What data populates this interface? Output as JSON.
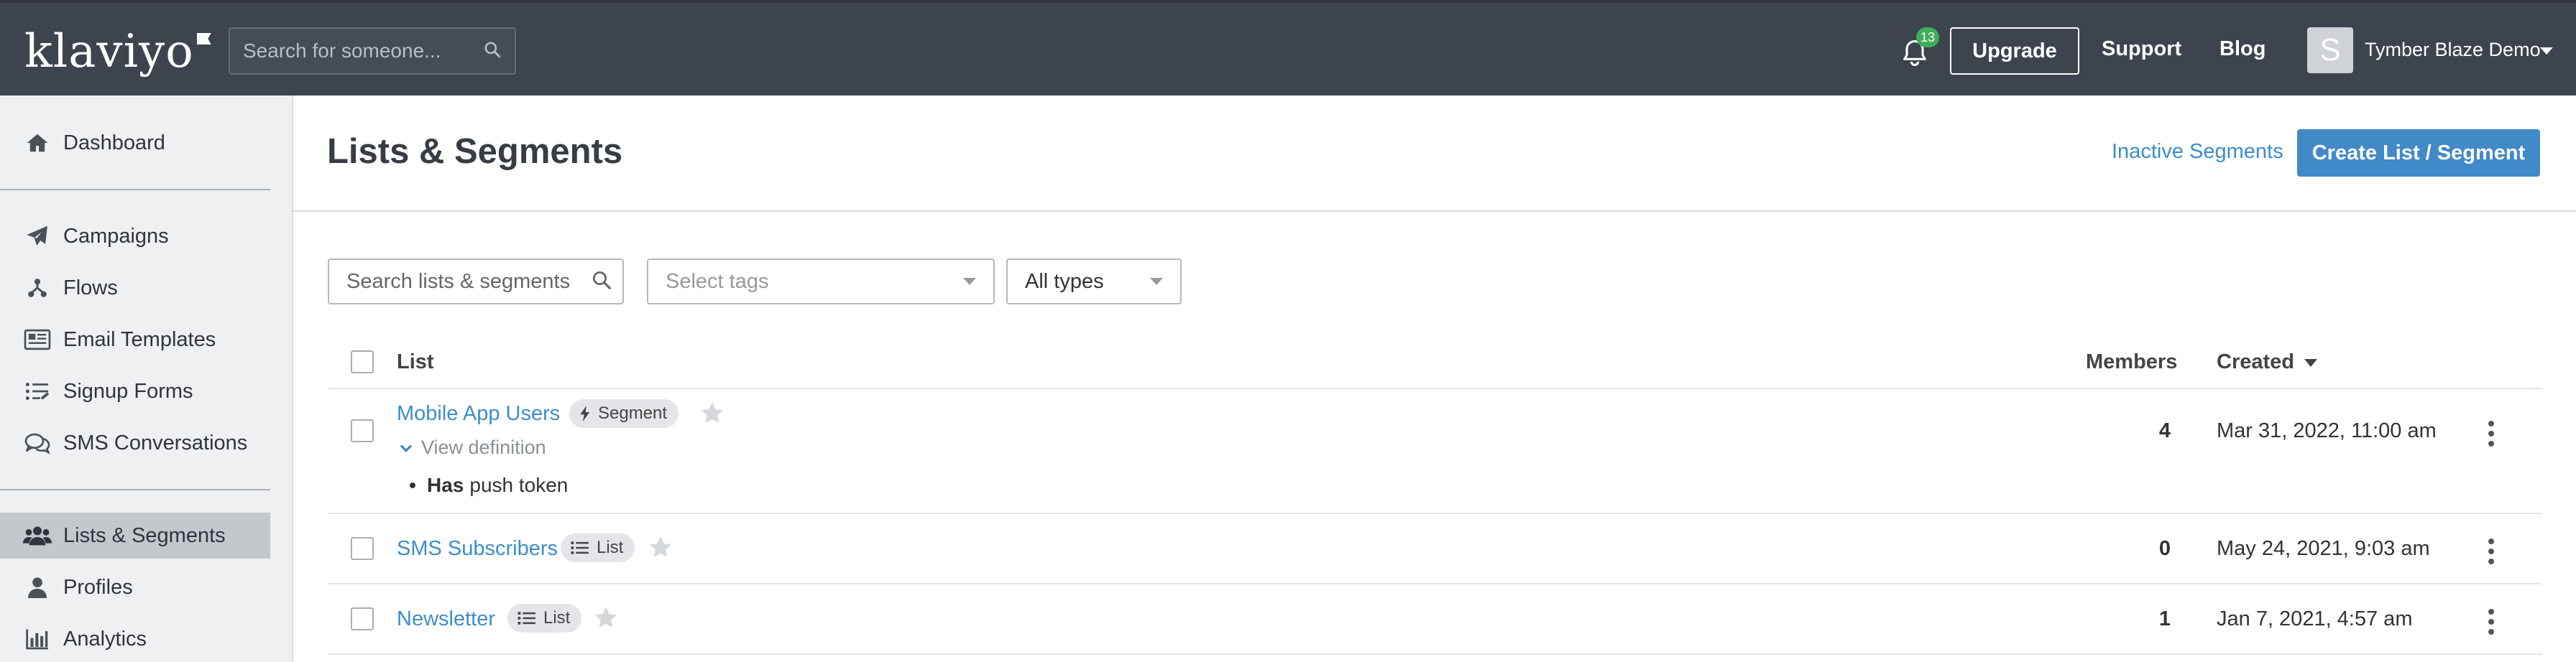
{
  "app": {
    "logo_text": "klaviyo",
    "search_placeholder": "Search for someone...",
    "notification_count": "13",
    "upgrade_label": "Upgrade",
    "support_label": "Support",
    "blog_label": "Blog",
    "avatar_initial": "S",
    "account_name": "Tymber Blaze Demo"
  },
  "sidebar": {
    "items": [
      {
        "label": "Dashboard",
        "icon": "home-icon"
      },
      {
        "label": "Campaigns",
        "icon": "paper-plane-icon"
      },
      {
        "label": "Flows",
        "icon": "flows-icon"
      },
      {
        "label": "Email Templates",
        "icon": "email-template-icon"
      },
      {
        "label": "Signup Forms",
        "icon": "signup-forms-icon"
      },
      {
        "label": "SMS Conversations",
        "icon": "chat-bubbles-icon"
      },
      {
        "label": "Lists & Segments",
        "icon": "users-icon",
        "active": true
      },
      {
        "label": "Profiles",
        "icon": "user-icon"
      },
      {
        "label": "Analytics",
        "icon": "bar-chart-icon"
      }
    ]
  },
  "page": {
    "title": "Lists & Segments",
    "inactive_segments_label": "Inactive Segments",
    "create_button_label": "Create List / Segment"
  },
  "filters": {
    "search_placeholder": "Search lists & segments",
    "tags_placeholder": "Select tags",
    "types_value": "All types"
  },
  "table": {
    "columns": {
      "list": "List",
      "members": "Members",
      "created": "Created"
    },
    "rows": [
      {
        "name": "Mobile App Users",
        "type": "Segment",
        "type_icon": "lightning-icon",
        "view_definition": "View definition",
        "definition_keyword": "Has",
        "definition_text": "push token",
        "members": "4",
        "created": "Mar 31, 2022, 11:00 am"
      },
      {
        "name": "SMS Subscribers",
        "type": "List",
        "type_icon": "list-icon",
        "members": "0",
        "created": "May 24, 2021, 9:03 am"
      },
      {
        "name": "Newsletter",
        "type": "List",
        "type_icon": "list-icon",
        "members": "1",
        "created": "Jan 7, 2021, 4:57 am"
      }
    ]
  },
  "colors": {
    "topbar": "#3d444d",
    "link_blue": "#3c8ec9",
    "primary_button": "#4289c8",
    "sidebar_bg": "#eef0f2",
    "sidebar_active": "#c3c8cd",
    "badge_green": "#3fae5a"
  }
}
